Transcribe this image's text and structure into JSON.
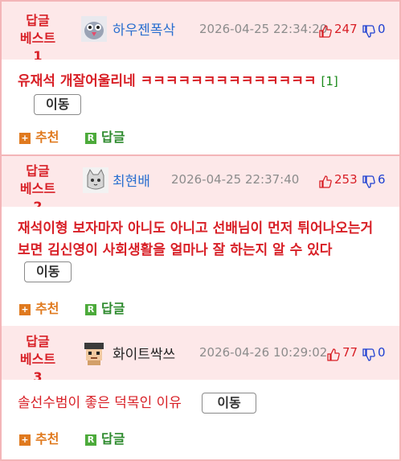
{
  "comments": [
    {
      "best_label_1": "답글",
      "best_label_2": "베스트1",
      "username": "하우젠폭삭",
      "timestamp": "2026-04-25 22:34:20",
      "likes": "247",
      "dislikes": "0",
      "content": "유재석 개잘어울리네 ㅋㅋㅋㅋㅋㅋㅋㅋㅋㅋㅋㅋㅋㅋ",
      "reply_count": "[1]",
      "move_label": "이동",
      "recommend_label": "추천",
      "reply_label": "답글",
      "username_color": "#2a6fcf"
    },
    {
      "best_label_1": "답글",
      "best_label_2": "베스트2",
      "username": "최현배",
      "timestamp": "2026-04-25 22:37:40",
      "likes": "253",
      "dislikes": "6",
      "content": "재석이형 보자마자 아니도 아니고 선배님이 먼저 튀어나오는거 보면 김신영이 사회생활을 얼마나 잘 하는지 알 수 있다",
      "move_label": "이동",
      "recommend_label": "추천",
      "reply_label": "답글",
      "username_color": "#2a6fcf"
    },
    {
      "best_label_1": "답글",
      "best_label_2": "베스트3",
      "username": "화이트싹쓰",
      "timestamp": "2026-04-26 10:29:02",
      "likes": "77",
      "dislikes": "0",
      "content": "솔선수범이 좋은 덕목인 이유",
      "move_label": "이동",
      "recommend_label": "추천",
      "reply_label": "답글",
      "username_color": "#222222"
    }
  ],
  "icons": {
    "avatar_1": "pigeon-avatar-icon",
    "avatar_2": "cat-avatar-icon",
    "avatar_3": "pixel-character-avatar-icon",
    "like": "thumbs-up-icon",
    "dislike": "thumbs-down-icon",
    "recommend": "plus-box-icon",
    "reply": "r-box-icon"
  },
  "colors": {
    "accent_red": "#d81f26",
    "header_bg": "#fde8e9",
    "border": "#f3b5b8",
    "recommend_orange": "#e07a1f",
    "reply_green": "#4caa3a",
    "dislike_blue": "#1d3fd1"
  }
}
